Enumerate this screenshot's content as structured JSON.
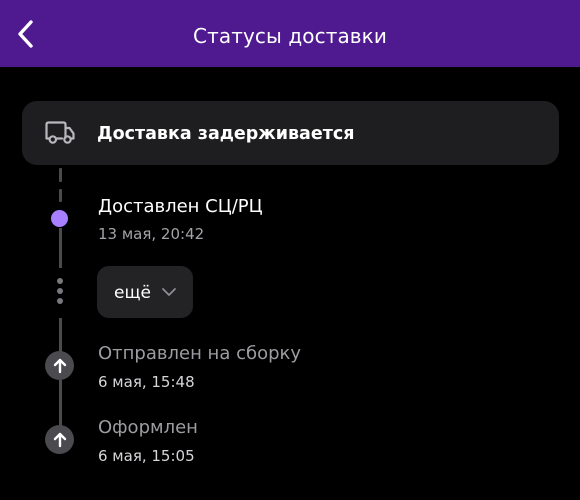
{
  "header": {
    "title": "Статусы доставки",
    "back_icon": "chevron-left-icon"
  },
  "delay_banner": {
    "icon": "truck-icon",
    "text": "Доставка задерживается"
  },
  "statuses": [
    {
      "title": "Доставлен СЦ/РЦ",
      "date": "13 мая, 20:42",
      "state": "current"
    },
    {
      "title": "Отправлен на сборку",
      "date": "6 мая, 15:48",
      "state": "past",
      "icon": "arrow-up-icon"
    },
    {
      "title": "Оформлен",
      "date": "6 мая, 15:05",
      "state": "past",
      "icon": "arrow-up-icon"
    }
  ],
  "more_button": {
    "label": "ещё",
    "icon": "chevron-down-icon"
  },
  "colors": {
    "header_bg": "#4f1a8f",
    "page_bg": "#000000",
    "card_bg": "#1e1e20",
    "active_dot": "#a87fff",
    "timeline": "#4a4a4f"
  }
}
